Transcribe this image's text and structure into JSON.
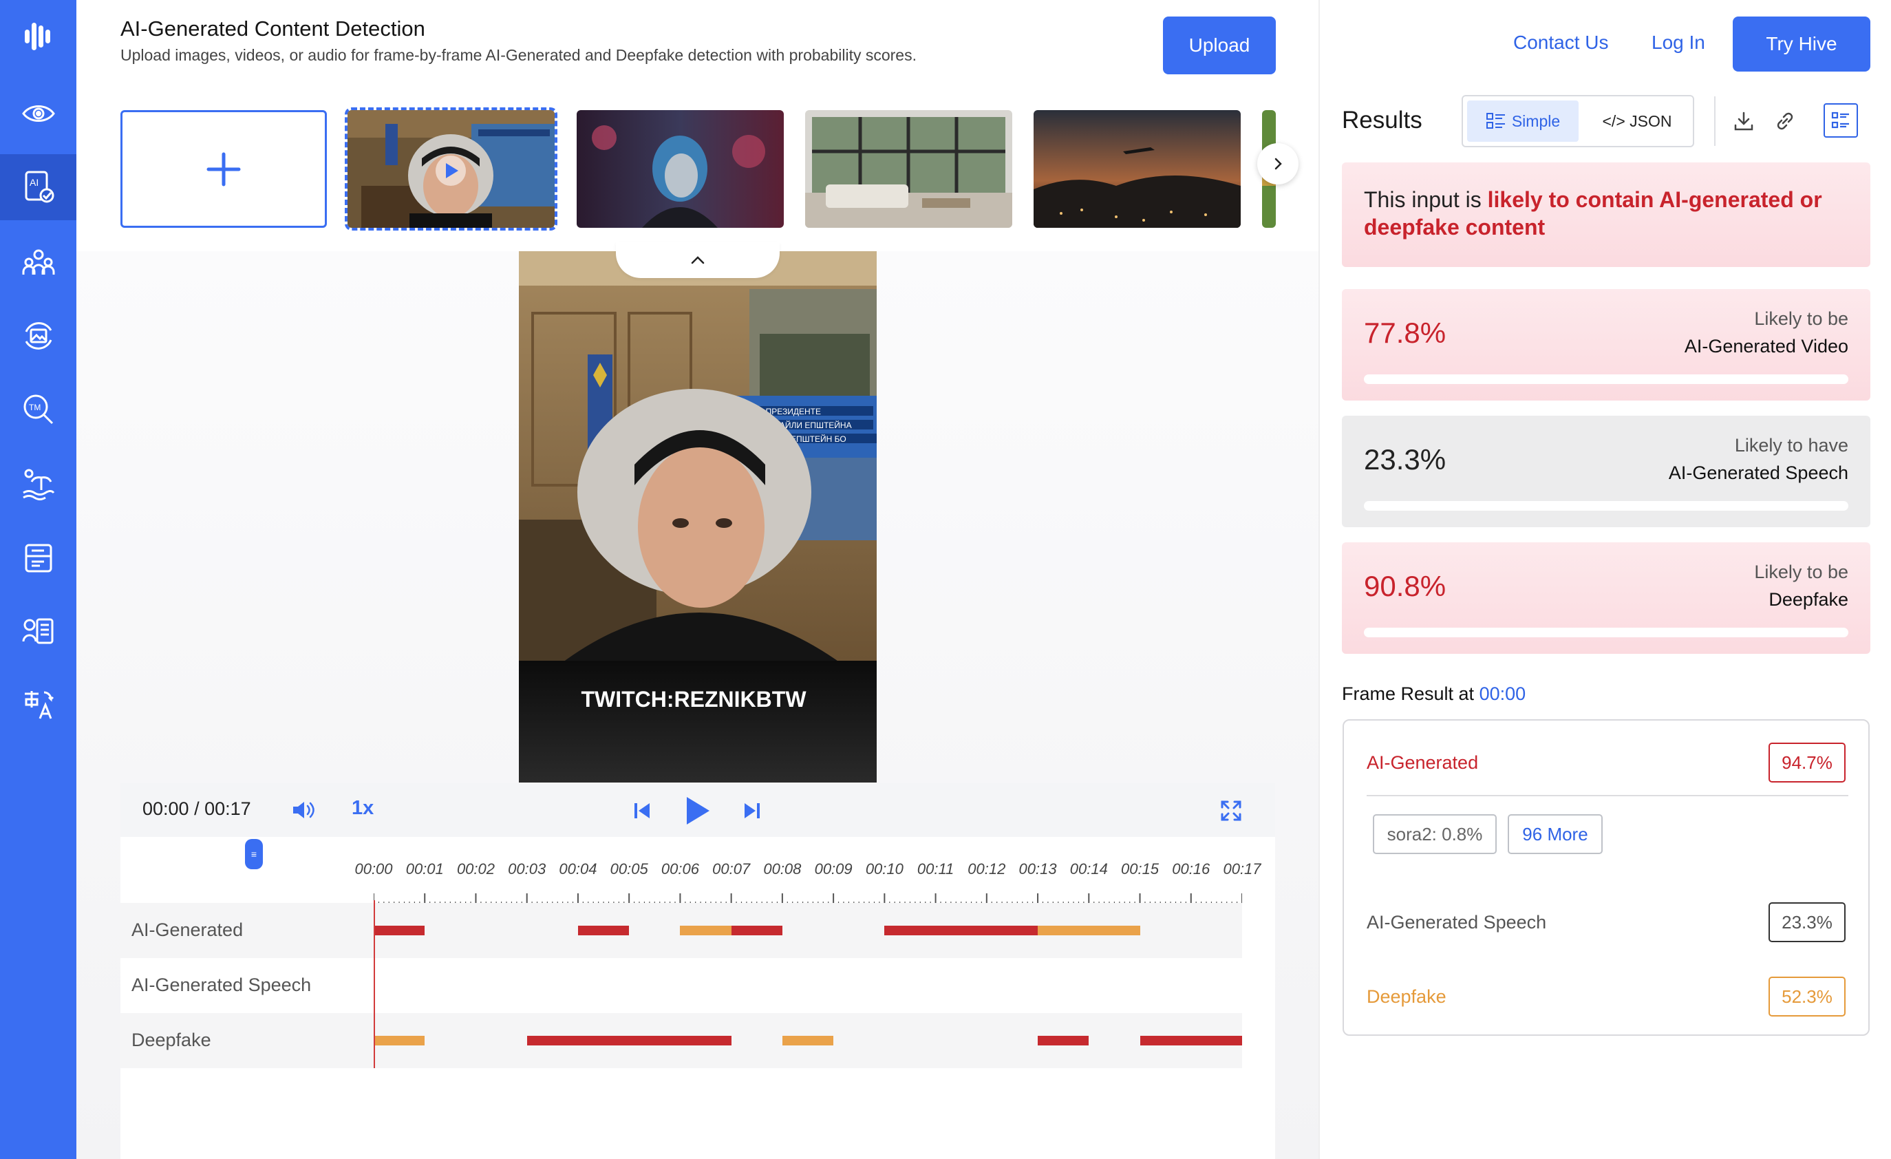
{
  "header": {
    "title": "AI-Generated Content Detection",
    "subtitle": "Upload images, videos, or audio for frame-by-frame AI-Generated and Deepfake detection with probability scores.",
    "upload_label": "Upload"
  },
  "nav": {
    "contact": "Contact Us",
    "login": "Log In",
    "try": "Try Hive"
  },
  "sidebar": {
    "icons": [
      "hive-logo-icon",
      "eye-scan-icon",
      "ai-document-icon",
      "people-group-icon",
      "image-refresh-icon",
      "trademark-search-icon",
      "island-scene-icon",
      "document-stack-icon",
      "speech-document-icon",
      "translate-icon"
    ],
    "active": "ai-document-icon"
  },
  "thumbnails": {
    "add_label": "+",
    "selected_index": 0
  },
  "video": {
    "overlay_text": "TWITCH:REZNIKBTW",
    "banner_lines": [
      "ПАНЕ ПРЕЗИДЕНТЕ",
      "ФАЙЛИ ЕПШТЕЙНА",
      "ЕПШТЕЙН БО"
    ]
  },
  "player": {
    "time": "00:00 / 00:17",
    "speed": "1x"
  },
  "timeline": {
    "ticks": [
      "00:00",
      "00:01",
      "00:02",
      "00:03",
      "00:04",
      "00:05",
      "00:06",
      "00:07",
      "00:08",
      "00:09",
      "00:10",
      "00:11",
      "00:12",
      "00:13",
      "00:14",
      "00:15",
      "00:16",
      "00:17"
    ],
    "duration_s": 17,
    "playhead_s": 0,
    "tracks": [
      {
        "label": "AI-Generated",
        "segments": [
          {
            "start": 0.0,
            "end": 1.0,
            "level": "high"
          },
          {
            "start": 4.0,
            "end": 5.0,
            "level": "high"
          },
          {
            "start": 6.0,
            "end": 7.0,
            "level": "medium"
          },
          {
            "start": 7.0,
            "end": 8.0,
            "level": "high"
          },
          {
            "start": 10.0,
            "end": 13.0,
            "level": "high"
          },
          {
            "start": 13.0,
            "end": 15.0,
            "level": "medium"
          }
        ]
      },
      {
        "label": "AI-Generated Speech",
        "segments": []
      },
      {
        "label": "Deepfake",
        "segments": [
          {
            "start": 0.0,
            "end": 1.0,
            "level": "medium"
          },
          {
            "start": 3.0,
            "end": 7.0,
            "level": "high"
          },
          {
            "start": 8.0,
            "end": 9.0,
            "level": "medium"
          },
          {
            "start": 13.0,
            "end": 14.0,
            "level": "high"
          },
          {
            "start": 15.0,
            "end": 17.0,
            "level": "high"
          }
        ]
      }
    ]
  },
  "results": {
    "title": "Results",
    "view_simple": "Simple",
    "view_json": "</> JSON",
    "verdict_prefix": "This input is ",
    "verdict_emphasis": "likely to contain AI-generated or deepfake content",
    "cards": [
      {
        "pct": "77.8%",
        "value": 0.778,
        "top": "Likely to be",
        "bottom": "AI-Generated Video",
        "tone": "pink"
      },
      {
        "pct": "23.3%",
        "value": 0.233,
        "top": "Likely to have",
        "bottom": "AI-Generated Speech",
        "tone": "grey"
      },
      {
        "pct": "90.8%",
        "value": 0.908,
        "top": "Likely to be",
        "bottom": "Deepfake",
        "tone": "pink"
      }
    ],
    "frame_result_label": "Frame Result at ",
    "frame_result_time": "00:00",
    "frame": {
      "ai_label": "AI-Generated",
      "ai_value": "94.7%",
      "chip_1": "sora2: 0.8%",
      "chip_more": "96 More",
      "speech_label": "AI-Generated Speech",
      "speech_value": "23.3%",
      "deepfake_label": "Deepfake",
      "deepfake_value": "52.3%"
    }
  },
  "colors": {
    "accent": "#3a6ef2",
    "high": "#c62a2f",
    "medium": "#eaa24a"
  }
}
